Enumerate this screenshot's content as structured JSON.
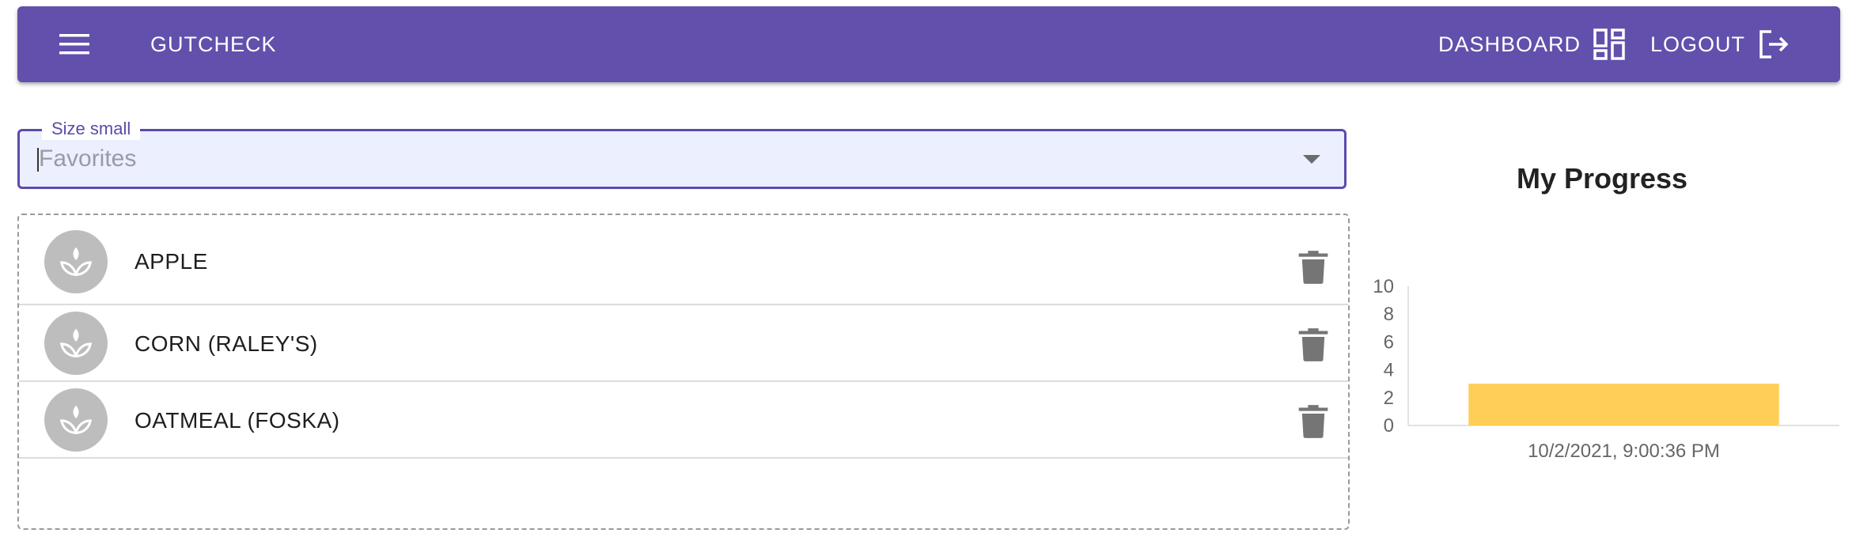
{
  "appbar": {
    "brand": "GUTCHECK",
    "menu_icon": "menu-icon",
    "dashboard_label": "DASHBOARD",
    "dashboard_icon": "dashboard-grid-icon",
    "logout_label": "LOGOUT",
    "logout_icon": "logout-icon"
  },
  "select": {
    "label": "Size small",
    "placeholder": "Favorites"
  },
  "favorites": [
    {
      "name": "APPLE",
      "icon": "spa-icon",
      "action_icon": "trash-icon"
    },
    {
      "name": "CORN (RALEY'S)",
      "icon": "spa-icon",
      "action_icon": "trash-icon"
    },
    {
      "name": "OATMEAL (FOSKA)",
      "icon": "spa-icon",
      "action_icon": "trash-icon"
    }
  ],
  "chart_data": {
    "type": "bar",
    "title": "My Progress",
    "categories": [
      "10/2/2021, 9:00:36 PM"
    ],
    "series": [
      {
        "values": [
          3
        ]
      }
    ],
    "ylim": [
      0,
      10
    ],
    "yticks": [
      0,
      2,
      4,
      6,
      8,
      10
    ],
    "bar_color": "#ffce56",
    "grid": false,
    "legend": "none"
  }
}
